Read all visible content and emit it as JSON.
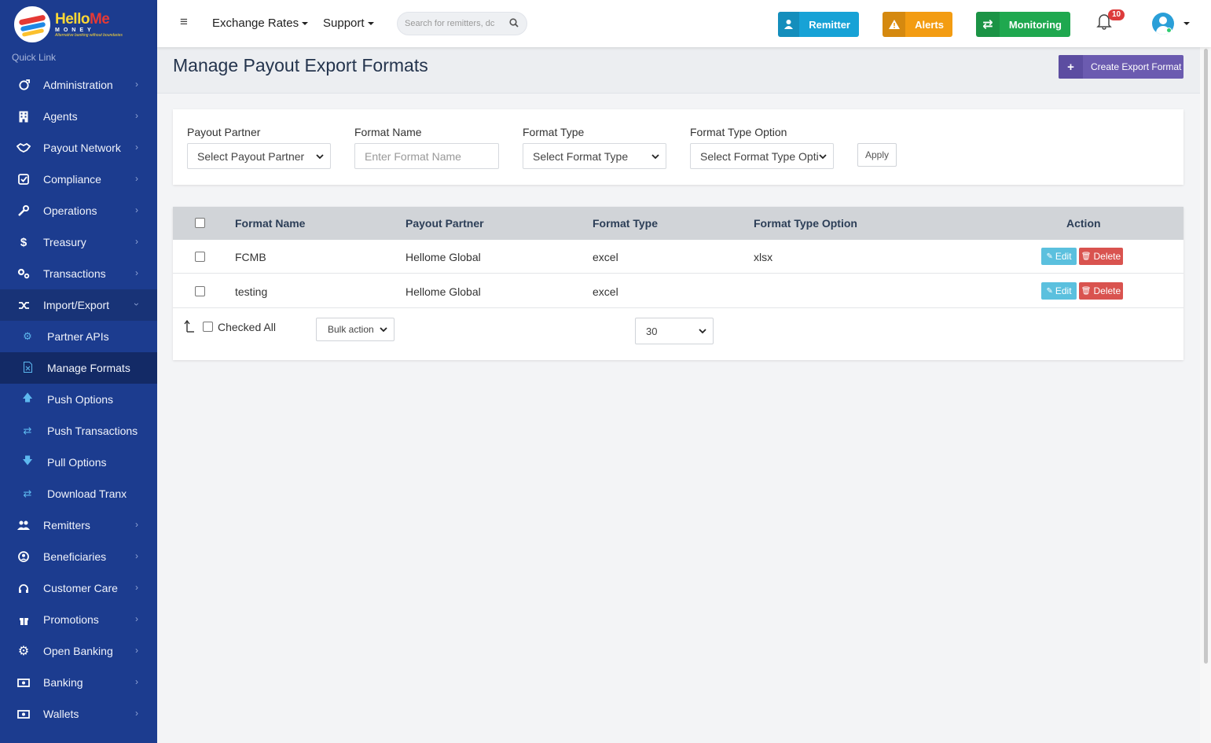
{
  "brand": {
    "name_a": "Hello",
    "name_b": "Me",
    "sub": "MONEY",
    "tagline": "Alternative banking without boundaries"
  },
  "sidebar": {
    "quick_link": "Quick Link",
    "items": [
      {
        "label": "Administration",
        "icon": "circle-arrow-icon"
      },
      {
        "label": "Agents",
        "icon": "building-icon"
      },
      {
        "label": "Payout Network",
        "icon": "handshake-icon"
      },
      {
        "label": "Compliance",
        "icon": "check-square-icon"
      },
      {
        "label": "Operations",
        "icon": "wrench-icon"
      },
      {
        "label": "Treasury",
        "icon": "dollar-icon"
      },
      {
        "label": "Transactions",
        "icon": "cogs-icon"
      },
      {
        "label": "Import/Export",
        "icon": "shuffle-icon"
      }
    ],
    "sub_items": [
      {
        "label": "Partner APIs",
        "icon": "gear-icon"
      },
      {
        "label": "Manage Formats",
        "icon": "excel-file-icon"
      },
      {
        "label": "Push Options",
        "icon": "arrow-up-icon"
      },
      {
        "label": "Push Transactions",
        "icon": "exchange-icon"
      },
      {
        "label": "Pull Options",
        "icon": "arrow-down-icon"
      },
      {
        "label": "Download Tranx",
        "icon": "exchange-icon"
      }
    ],
    "items_after": [
      {
        "label": "Remitters",
        "icon": "users-icon"
      },
      {
        "label": "Beneficiaries",
        "icon": "user-circle-icon"
      },
      {
        "label": "Customer Care",
        "icon": "headphones-icon"
      },
      {
        "label": "Promotions",
        "icon": "gift-icon"
      },
      {
        "label": "Open Banking",
        "icon": "gear-icon"
      },
      {
        "label": "Banking",
        "icon": "money-bill-icon"
      },
      {
        "label": "Wallets",
        "icon": "money-bill-icon"
      }
    ]
  },
  "topbar": {
    "exchange_rates": "Exchange Rates",
    "support": "Support",
    "search_placeholder": "Search for remitters, dc",
    "remitter": "Remitter",
    "alerts": "Alerts",
    "monitoring": "Monitoring",
    "notification_count": "10"
  },
  "page": {
    "title": "Manage Payout Export Formats",
    "create_button": "Create Export Format"
  },
  "filters": {
    "payout_partner_label": "Payout Partner",
    "payout_partner_value": "Select Payout Partner",
    "format_name_label": "Format Name",
    "format_name_placeholder": "Enter Format Name",
    "format_type_label": "Format Type",
    "format_type_value": "Select Format Type",
    "format_type_option_label": "Format Type Option",
    "format_type_option_value": "Select Format Type Optic",
    "apply": "Apply"
  },
  "table": {
    "headers": {
      "format_name": "Format Name",
      "payout_partner": "Payout Partner",
      "format_type": "Format Type",
      "format_type_option": "Format Type Option",
      "action": "Action"
    },
    "rows": [
      {
        "format_name": "FCMB",
        "payout_partner": "Hellome Global",
        "format_type": "excel",
        "format_type_option": "xlsx"
      },
      {
        "format_name": "testing",
        "payout_partner": "Hellome Global",
        "format_type": "excel",
        "format_type_option": ""
      }
    ],
    "edit_label": "Edit",
    "delete_label": "Delete",
    "checked_all": "Checked All",
    "bulk_action": "Bulk action",
    "page_size": "30"
  },
  "colors": {
    "sidebar": "#1c3c8f",
    "remitter": "#17a2d6",
    "alerts": "#f39c12",
    "monitoring": "#1fa84f",
    "create": "#6b5bb0",
    "edit": "#5bc0de",
    "delete": "#d9534f"
  }
}
